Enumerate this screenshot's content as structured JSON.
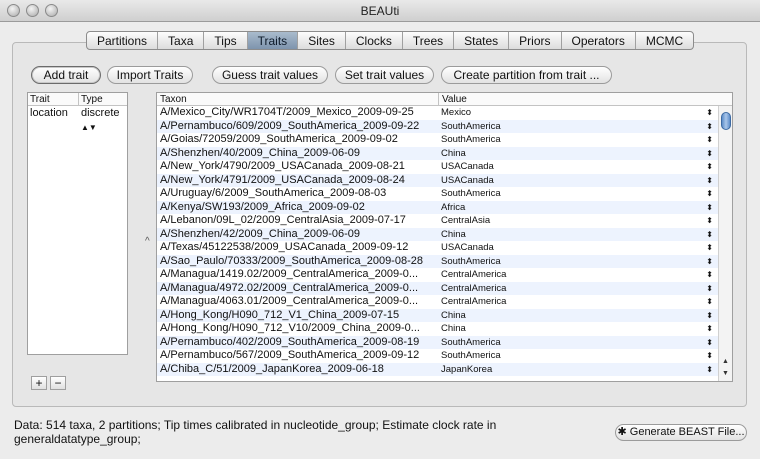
{
  "window": {
    "title": "BEAUti"
  },
  "tabs": [
    "Partitions",
    "Taxa",
    "Tips",
    "Traits",
    "Sites",
    "Clocks",
    "Trees",
    "States",
    "Priors",
    "Operators",
    "MCMC"
  ],
  "selected_tab": "Traits",
  "toolbar": {
    "add_trait": "Add trait",
    "import_traits": "Import Traits",
    "guess_trait_values": "Guess trait values",
    "set_trait_values": "Set trait values",
    "create_partition": "Create partition from trait ..."
  },
  "traits_table": {
    "headers": [
      "Trait",
      "Type"
    ],
    "rows": [
      {
        "trait": "location",
        "type": "discrete"
      }
    ]
  },
  "trait_buttons": {
    "add": "+",
    "remove": "−"
  },
  "values_table": {
    "headers": [
      "Taxon",
      "Value"
    ],
    "rows": [
      {
        "taxon": "A/Mexico_City/WR1704T/2009_Mexico_2009-09-25",
        "value": "Mexico"
      },
      {
        "taxon": "A/Pernambuco/609/2009_SouthAmerica_2009-09-22",
        "value": "SouthAmerica"
      },
      {
        "taxon": "A/Goias/72059/2009_SouthAmerica_2009-09-02",
        "value": "SouthAmerica"
      },
      {
        "taxon": "A/Shenzhen/40/2009_China_2009-06-09",
        "value": "China"
      },
      {
        "taxon": "A/New_York/4790/2009_USACanada_2009-08-21",
        "value": "USACanada"
      },
      {
        "taxon": "A/New_York/4791/2009_USACanada_2009-08-24",
        "value": "USACanada"
      },
      {
        "taxon": "A/Uruguay/6/2009_SouthAmerica_2009-08-03",
        "value": "SouthAmerica"
      },
      {
        "taxon": "A/Kenya/SW193/2009_Africa_2009-09-02",
        "value": "Africa"
      },
      {
        "taxon": "A/Lebanon/09L_02/2009_CentralAsia_2009-07-17",
        "value": "CentralAsia"
      },
      {
        "taxon": "A/Shenzhen/42/2009_China_2009-06-09",
        "value": "China"
      },
      {
        "taxon": "A/Texas/45122538/2009_USACanada_2009-09-12",
        "value": "USACanada"
      },
      {
        "taxon": "A/Sao_Paulo/70333/2009_SouthAmerica_2009-08-28",
        "value": "SouthAmerica"
      },
      {
        "taxon": "A/Managua/1419.02/2009_CentralAmerica_2009-0...",
        "value": "CentralAmerica"
      },
      {
        "taxon": "A/Managua/4972.02/2009_CentralAmerica_2009-0...",
        "value": "CentralAmerica"
      },
      {
        "taxon": "A/Managua/4063.01/2009_CentralAmerica_2009-0...",
        "value": "CentralAmerica"
      },
      {
        "taxon": "A/Hong_Kong/H090_712_V1_China_2009-07-15",
        "value": "China"
      },
      {
        "taxon": "A/Hong_Kong/H090_712_V10/2009_China_2009-0...",
        "value": "China"
      },
      {
        "taxon": "A/Pernambuco/402/2009_SouthAmerica_2009-08-19",
        "value": "SouthAmerica"
      },
      {
        "taxon": "A/Pernambuco/567/2009_SouthAmerica_2009-09-12",
        "value": "SouthAmerica"
      },
      {
        "taxon": "A/Chiba_C/51/2009_JapanKorea_2009-06-18",
        "value": "JapanKorea"
      }
    ]
  },
  "status": "Data: 514 taxa, 2 partitions; Tip times calibrated in nucleotide_group; Estimate clock rate in generaldatatype_group;",
  "generate_button": "Generate BEAST File..."
}
